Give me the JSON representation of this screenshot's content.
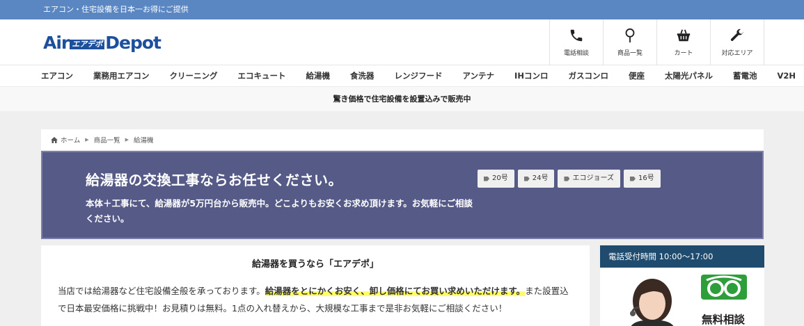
{
  "topbar": {
    "text": "エアコン・住宅設備を日本一お得にご提供"
  },
  "logo": {
    "air": "Air",
    "kana": "エアデポ",
    "depot": "Depot"
  },
  "header_nav": [
    {
      "label": "電話相談",
      "icon": "phone-icon"
    },
    {
      "label": "商品一覧",
      "icon": "pin-icon"
    },
    {
      "label": "カート",
      "icon": "basket-icon"
    },
    {
      "label": "対応エリア",
      "icon": "wrench-icon"
    }
  ],
  "global_nav": [
    "エアコン",
    "業務用エアコン",
    "クリーニング",
    "エコキュート",
    "給湯機",
    "食洗器",
    "レンジフード",
    "アンテナ",
    "IHコンロ",
    "ガスコンロ",
    "便座",
    "太陽光パネル",
    "蓄電池",
    "V2H"
  ],
  "notice": "驚き価格で住宅設備を設置込みで販売中",
  "breadcrumb": {
    "home": "ホーム",
    "list": "商品一覧",
    "current": "給湯機"
  },
  "hero": {
    "title": "給湯器の交換工事ならお任せください。",
    "desc": "本体＋工事にて、給湯器が5万円台から販売中。どこよりもお安くお求め頂けます。お気軽にご相談ください。",
    "tags": [
      "20号",
      "24号",
      "エコジョーズ",
      "16号"
    ]
  },
  "main": {
    "title": "給湯器を買うなら「エアデポ」",
    "text_before": "当店では給湯器など住宅設備全般を承っております。",
    "text_highlight": "給湯器をとにかくお安く、卸し価格にてお買い求めいただけます。",
    "text_after": "また設置込で日本最安価格に挑戦中！お見積りは無料。1点の入れ替えから、大規模な工事まで是非お気軽にご相談ください！"
  },
  "side": {
    "head": "電話受付時間 10:00〜17:00",
    "free_label": "無料相談"
  },
  "colors": {
    "topbar": "#5a86c2",
    "hero": "#565a87",
    "side_head": "#1f4b6e",
    "logo": "#1c4f9c",
    "freedial": "#2e9e3b"
  }
}
